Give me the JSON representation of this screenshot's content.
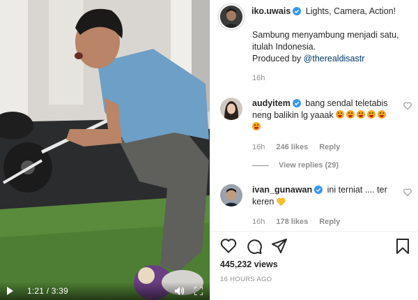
{
  "video": {
    "time": "1:21 / 3:39",
    "icons": {
      "play": "play-icon",
      "volume": "volume-icon",
      "fullscreen": "fullscreen-icon"
    }
  },
  "post": {
    "username": "iko.uwais",
    "title": "Lights, Camera, Action!",
    "caption_line1": "Sambung menyambung menjadi satu,",
    "caption_line2": "itulah Indonesia.",
    "produced_by": "Produced by ",
    "mention": "@therealdisastr",
    "time": "16h"
  },
  "comments": [
    {
      "username": "audyitem",
      "text": "bang sendal teletabis neng balikin lg yaaak",
      "time": "16h",
      "likes": "246 likes",
      "reply": "Reply",
      "view_replies": "View replies (29)"
    },
    {
      "username": "ivan_gunawan",
      "text": "ini terniat .... ter keren",
      "time": "16h",
      "likes": "178 likes",
      "reply": "Reply"
    }
  ],
  "stats": {
    "views": "445,232 views",
    "posted": "16 HOURS AGO"
  },
  "colors": {
    "verified": "#3897f0",
    "link": "#00376b",
    "muted": "#8e8e8e"
  }
}
